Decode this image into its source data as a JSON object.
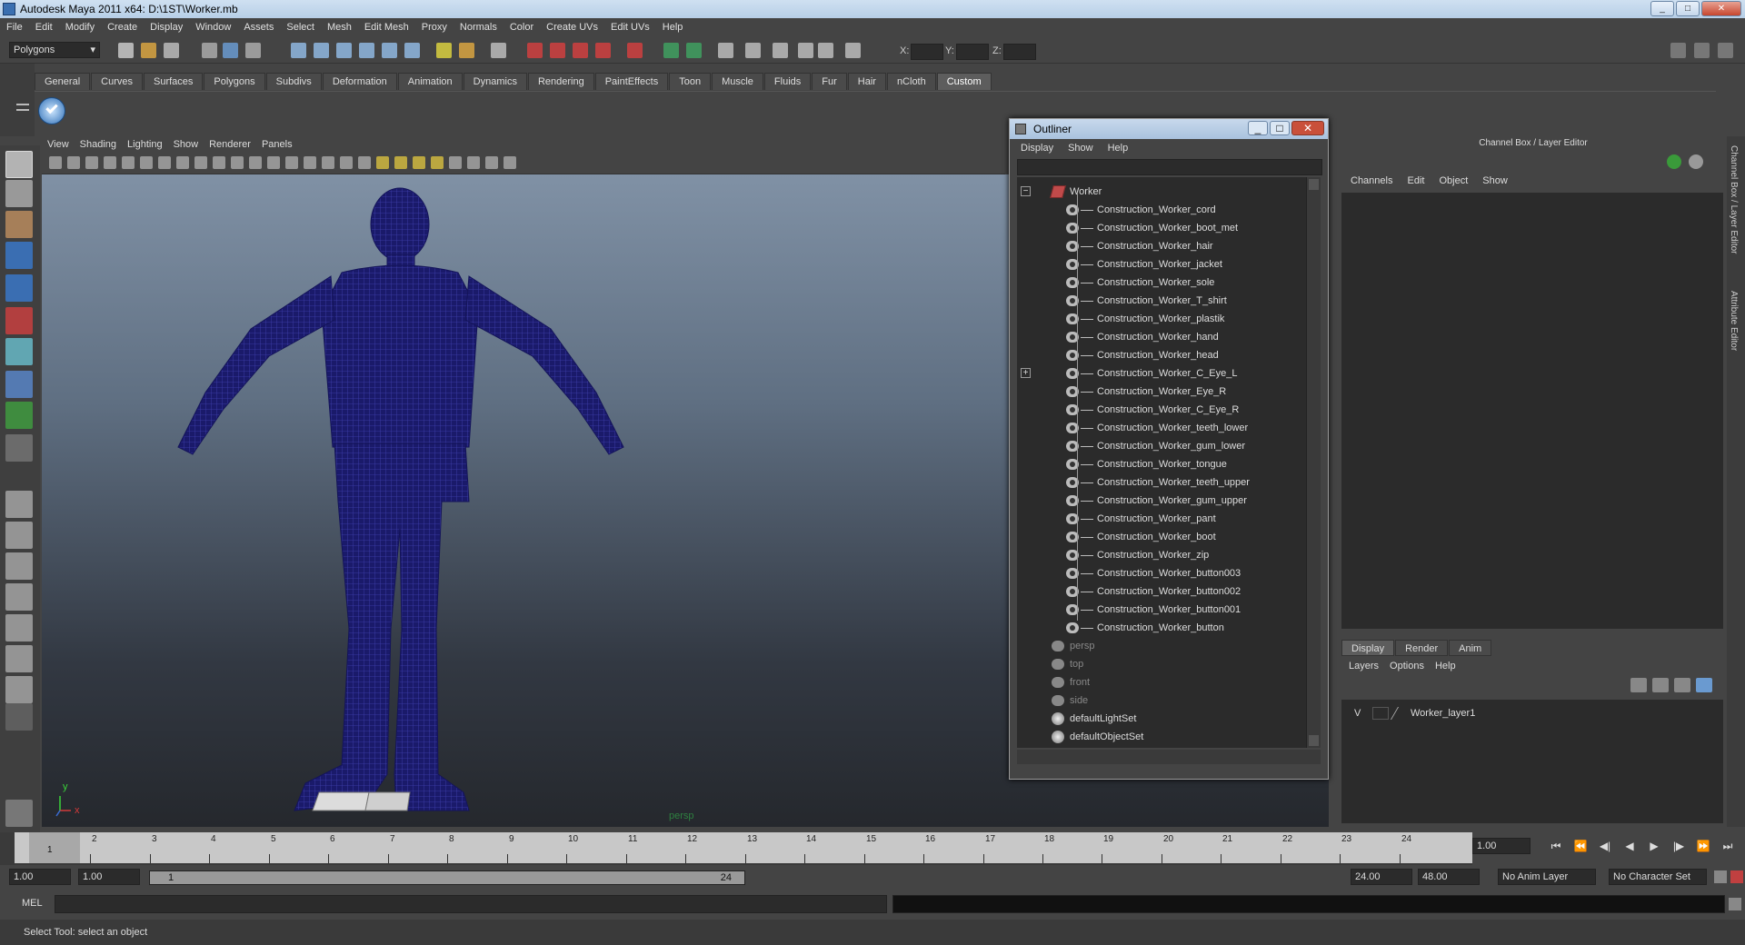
{
  "window": {
    "title": "Autodesk Maya 2011 x64: D:\\1ST\\Worker.mb",
    "min": "_",
    "max": "□",
    "close": "✕"
  },
  "menubar": [
    "File",
    "Edit",
    "Modify",
    "Create",
    "Display",
    "Window",
    "Assets",
    "Select",
    "Mesh",
    "Edit Mesh",
    "Proxy",
    "Normals",
    "Color",
    "Create UVs",
    "Edit UVs",
    "Help"
  ],
  "toolbar": {
    "mode": "Polygons",
    "x_label": "X:",
    "y_label": "Y:",
    "z_label": "Z:"
  },
  "shelf_tabs": [
    "General",
    "Curves",
    "Surfaces",
    "Polygons",
    "Subdivs",
    "Deformation",
    "Animation",
    "Dynamics",
    "Rendering",
    "PaintEffects",
    "Toon",
    "Muscle",
    "Fluids",
    "Fur",
    "Hair",
    "nCloth",
    "Custom"
  ],
  "shelf_active": "Custom",
  "viewport": {
    "menu": [
      "View",
      "Shading",
      "Lighting",
      "Show",
      "Renderer",
      "Panels"
    ],
    "camera_label": "persp",
    "axis_y": "y",
    "axis_x": "x"
  },
  "outliner": {
    "title": "Outliner",
    "menu": [
      "Display",
      "Show",
      "Help"
    ],
    "root": "Worker",
    "children": [
      "Construction_Worker_cord",
      "Construction_Worker_boot_met",
      "Construction_Worker_hair",
      "Construction_Worker_jacket",
      "Construction_Worker_sole",
      "Construction_Worker_T_shirt",
      "Construction_Worker_plastik",
      "Construction_Worker_hand",
      "Construction_Worker_head",
      "Construction_Worker_C_Eye_L",
      "Construction_Worker_Eye_R",
      "Construction_Worker_C_Eye_R",
      "Construction_Worker_teeth_lower",
      "Construction_Worker_gum_lower",
      "Construction_Worker_tongue",
      "Construction_Worker_teeth_upper",
      "Construction_Worker_gum_upper",
      "Construction_Worker_pant",
      "Construction_Worker_boot",
      "Construction_Worker_zip",
      "Construction_Worker_button003",
      "Construction_Worker_button002",
      "Construction_Worker_button001",
      "Construction_Worker_button"
    ],
    "cameras": [
      "persp",
      "top",
      "front",
      "side"
    ],
    "sets": [
      "defaultLightSet",
      "defaultObjectSet"
    ]
  },
  "channelbox": {
    "title": "Channel Box / Layer Editor",
    "menu": [
      "Channels",
      "Edit",
      "Object",
      "Show"
    ]
  },
  "layers": {
    "tabs": [
      "Display",
      "Render",
      "Anim"
    ],
    "active": "Display",
    "menu": [
      "Layers",
      "Options",
      "Help"
    ],
    "items": [
      {
        "visibility": "V",
        "name": "Worker_layer1"
      }
    ]
  },
  "sidebar": {
    "channel_tab": "Channel Box / Layer Editor",
    "attr_tab": "Attribute Editor"
  },
  "timeline": {
    "ticks": [
      "1",
      "2",
      "3",
      "4",
      "5",
      "6",
      "7",
      "8",
      "9",
      "10",
      "11",
      "12",
      "13",
      "14",
      "15",
      "16",
      "17",
      "18",
      "19",
      "20",
      "21",
      "22",
      "23",
      "24"
    ],
    "current": "1",
    "current_field": "1.00"
  },
  "range": {
    "start": "1.00",
    "start2": "1.00",
    "slider_start": "1",
    "slider_end": "24",
    "end": "24.00",
    "end2": "48.00",
    "anim_layer": "No Anim Layer",
    "char_set": "No Character Set"
  },
  "cmd": {
    "label": "MEL"
  },
  "helpline": "Select Tool: select an object"
}
